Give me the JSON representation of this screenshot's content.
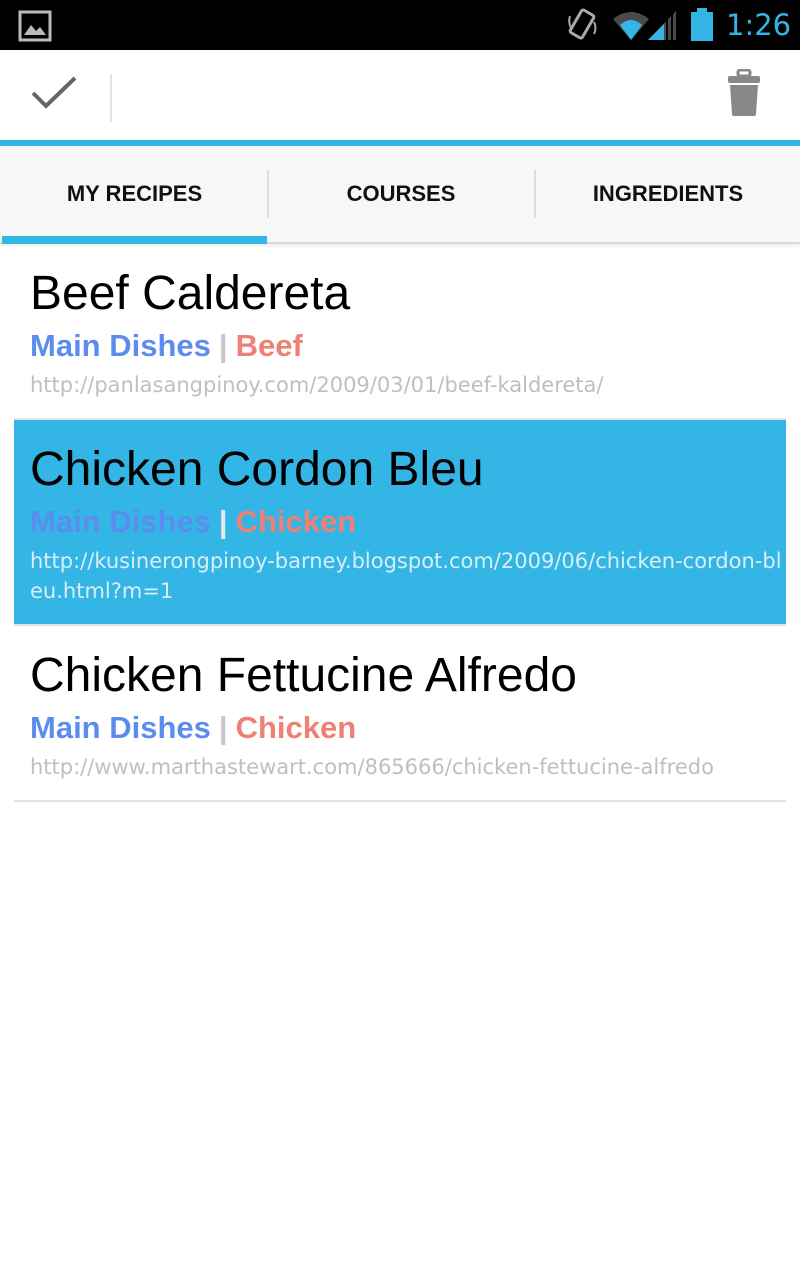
{
  "status_bar": {
    "time": "1:26",
    "icons": [
      "gallery-icon",
      "rotate-icon",
      "wifi-icon",
      "signal-icon",
      "battery-icon"
    ]
  },
  "action_bar": {
    "done_icon": "checkmark-icon",
    "delete_icon": "trash-icon"
  },
  "tabs": [
    {
      "label": "MY RECIPES",
      "selected": true
    },
    {
      "label": "COURSES",
      "selected": false
    },
    {
      "label": "INGREDIENTS",
      "selected": false
    }
  ],
  "recipes": [
    {
      "title": "Beef Caldereta",
      "course": "Main Dishes",
      "separator": "|",
      "ingredient": "Beef",
      "url": "http://panlasangpinoy.com/2009/03/01/beef-kaldereta/",
      "selected": false
    },
    {
      "title": "Chicken Cordon Bleu",
      "course": "Main Dishes",
      "separator": "|",
      "ingredient": "Chicken",
      "url": "http://kusinerongpinoy-barney.blogspot.com/2009/06/chicken-cordon-bleu.html?m=1",
      "selected": true
    },
    {
      "title": "Chicken Fettucine Alfredo",
      "course": "Main Dishes",
      "separator": "|",
      "ingredient": "Chicken",
      "url": "http://www.marthastewart.com/865666/chicken-fettucine-alfredo",
      "selected": false
    }
  ],
  "colors": {
    "accent": "#33b5e5",
    "course": "#5b8def",
    "ingredient": "#f07f75",
    "url": "#bfbfbf"
  }
}
